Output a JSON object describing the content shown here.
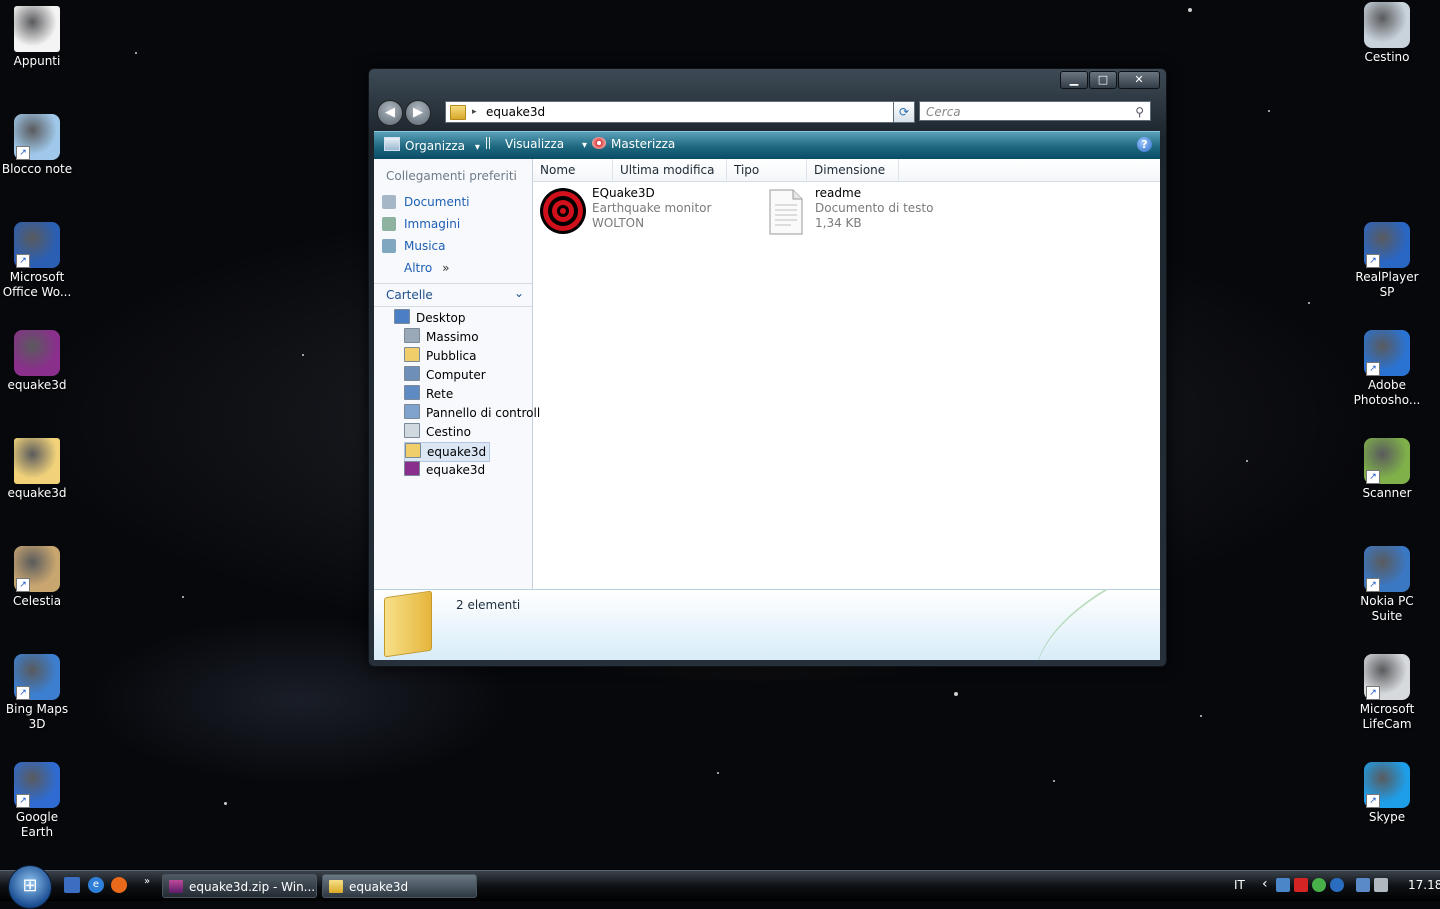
{
  "desktop": {
    "left_icons": [
      {
        "label": "Appunti",
        "icon": "note-icon",
        "color": "#f4f4f4",
        "shortcut": false
      },
      {
        "label": "Blocco note",
        "icon": "notepad-icon",
        "color": "#9fc8ea",
        "shortcut": true
      },
      {
        "label": "Microsoft Office Wo...",
        "icon": "word-icon",
        "color": "#2b5fb4",
        "shortcut": true
      },
      {
        "label": "equake3d",
        "icon": "winrar-archive-icon",
        "color": "#8a2f8c",
        "shortcut": false
      },
      {
        "label": "equake3d",
        "icon": "folder-icon",
        "color": "#f1d27a",
        "shortcut": false
      },
      {
        "label": "Celestia",
        "icon": "planet-icon",
        "color": "#c9a670",
        "shortcut": true
      },
      {
        "label": "Bing Maps 3D",
        "icon": "globe-buildings-icon",
        "color": "#3c7fd0",
        "shortcut": true
      },
      {
        "label": "Google Earth",
        "icon": "earth-icon",
        "color": "#2f6bd0",
        "shortcut": true
      }
    ],
    "right_icons": [
      {
        "label": "Cestino",
        "icon": "recycle-bin-icon",
        "color": "#c9d3dc",
        "shortcut": false
      },
      {
        "label": "RealPlayer SP",
        "icon": "realplayer-icon",
        "color": "#2a66c4",
        "shortcut": true
      },
      {
        "label": "Adobe Photosho...",
        "icon": "camera-icon",
        "color": "#2b73d2",
        "shortcut": true
      },
      {
        "label": "Scanner",
        "icon": "scanner-icon",
        "color": "#7fb04a",
        "shortcut": true
      },
      {
        "label": "Nokia PC Suite",
        "icon": "phone-icon",
        "color": "#3b78c4",
        "shortcut": true
      },
      {
        "label": "Microsoft LifeCam",
        "icon": "webcam-icon",
        "color": "#d7dadd",
        "shortcut": true
      },
      {
        "label": "Skype",
        "icon": "skype-icon",
        "color": "#1e9ee8",
        "shortcut": true
      }
    ]
  },
  "window": {
    "controls": {
      "minimize": "▁",
      "maximize": "□",
      "close": "✕"
    },
    "address": {
      "path": "equake3d",
      "separator": "▸",
      "dropdown": "▾"
    },
    "search": {
      "placeholder": "Cerca",
      "icon": "⚲"
    },
    "toolbar": {
      "organize": "Organizza",
      "view": "Visualizza",
      "burn": "Masterizza",
      "help": "?",
      "dropdown": "▾"
    },
    "nav": {
      "favorites_title": "Collegamenti preferiti",
      "favorites": [
        "Documenti",
        "Immagini",
        "Musica"
      ],
      "more": "Altro",
      "more_chevron": "»",
      "folders_title": "Cartelle",
      "folders_chevron": "⌄",
      "tree": [
        {
          "label": "Desktop",
          "icon": "desktop-icon",
          "color": "#4a7fc6",
          "level": 0,
          "selected": false
        },
        {
          "label": "Massimo",
          "icon": "user-folder-icon",
          "color": "#9aa9b8",
          "level": 1,
          "selected": false
        },
        {
          "label": "Pubblica",
          "icon": "folder-icon",
          "color": "#f0cf6a",
          "level": 1,
          "selected": false
        },
        {
          "label": "Computer",
          "icon": "computer-icon",
          "color": "#6d8fb8",
          "level": 1,
          "selected": false
        },
        {
          "label": "Rete",
          "icon": "network-icon",
          "color": "#5f8bc4",
          "level": 1,
          "selected": false
        },
        {
          "label": "Pannello di controll",
          "icon": "control-panel-icon",
          "color": "#7fa3cc",
          "level": 1,
          "selected": false
        },
        {
          "label": "Cestino",
          "icon": "recycle-bin-icon",
          "color": "#d0d8e0",
          "level": 1,
          "selected": false
        },
        {
          "label": "equake3d",
          "icon": "folder-icon",
          "color": "#f0cf6a",
          "level": 1,
          "selected": true
        },
        {
          "label": "equake3d",
          "icon": "winrar-archive-icon",
          "color": "#8a2f8c",
          "level": 1,
          "selected": false
        }
      ]
    },
    "columns": [
      "Nome",
      "Ultima modifica",
      "Tipo",
      "Dimensione"
    ],
    "files": [
      {
        "name": "EQuake3D",
        "line2": "Earthquake monitor",
        "line3": "WOLTON",
        "icon": "target-icon"
      },
      {
        "name": "readme",
        "line2": "Documento di testo",
        "line3": "1,34 KB",
        "icon": "text-document-icon"
      }
    ],
    "details": {
      "count": "2 elementi"
    }
  },
  "taskbar": {
    "start_glyph": "⊞",
    "quicklaunch_more": "»",
    "buttons": [
      {
        "label": "equake3d.zip - Win...",
        "icon": "winrar-icon",
        "color": "#8a2f8c"
      },
      {
        "label": "equake3d",
        "icon": "folder-icon",
        "color": "#f0cf6a"
      }
    ],
    "tray": {
      "lang": "IT",
      "arrow": "‹",
      "time": "17.18"
    }
  },
  "colors": {
    "toolbar": "#1e6880",
    "link": "#1e5fb4",
    "target_red": "#d0101a"
  }
}
